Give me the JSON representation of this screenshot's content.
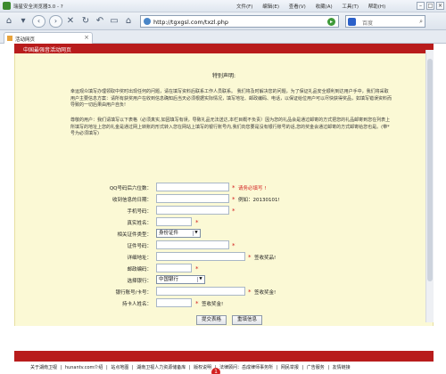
{
  "browser": {
    "title": "瑞星安全浏览器3.0 - ?",
    "menu": [
      "文件(F)",
      "编辑(E)",
      "查看(V)",
      "收藏(A)",
      "工具(T)",
      "帮助(H)"
    ],
    "url": "http://tgxgsl.com/txzl.php",
    "search_placeholder": "百度",
    "tab_label": "活动网页"
  },
  "page": {
    "banner_title": "中国最强音活动网页",
    "heading": "特别声明:",
    "intro_1": "幸运观众填写办理领取中奖时出现任何的问题，请在填写资料后联系工作人员联系。 我们将及时解决您的问题，为了保证礼品安全顺利到达用户手中，我们将采取用户主要信息方案：请所有获奖用户在收到信息确知后当天必须根据实际情况，填写地址、邮政编码、电话，以保证给位用户可以尽快获得奖品，如填写错误资料而导致的一切后果由用户自负!",
    "intro_2": "尊敬的用户：我们请填写以下表格（必须真实,如因填写有误，导致礼品无法送达,本栏目概不负责）因为您的礼品会是通过邮寄的方式把您的礼品邮寄到您在列表上所填写的地址上您的礼金是通过网上转账的形式转入您在网站上填写的银行账号内,我们向您要是没有银行账号的话,您的奖金会通过邮寄的方式邮寄给您也是。(带*号为必须填写)"
  },
  "form": {
    "qq_label": "QQ号码后六位数：",
    "qq_note": "请务必填写 !",
    "date_label": "收到信息的日期：",
    "date_note": "例如：20130101!",
    "phone_label": "手机号码：",
    "name_label": "真实姓名：",
    "idtype_label": "相关证件类型：",
    "idtype_value": "身份证件",
    "idnum_label": "证件号码：",
    "address_label": "详细地址：",
    "address_note": "签收奖品!",
    "zip_label": "邮政编码：",
    "bank_label": "选择银行：",
    "bank_value": "中国银行",
    "account_label": "银行账号/卡号：",
    "account_note": "签收奖金!",
    "holder_label": "持卡人姓名：",
    "holder_note": "签收奖金!",
    "submit": "提交表格",
    "reset": "重填信息",
    "star": "*"
  },
  "footer": {
    "links": [
      "关于湖南卫视",
      "hunantv.com介绍",
      "站点地图",
      "湖南卫视人力资源储备库",
      "版权说明",
      "法律顾问：岳成律师事务所",
      "网民举报",
      "广告服务",
      "友情链接"
    ],
    "separator": "|",
    "badge": "1"
  },
  "colors": {
    "banner": "#b81c1c",
    "panel": "#fbf9d5",
    "required": "#d21d1d"
  }
}
